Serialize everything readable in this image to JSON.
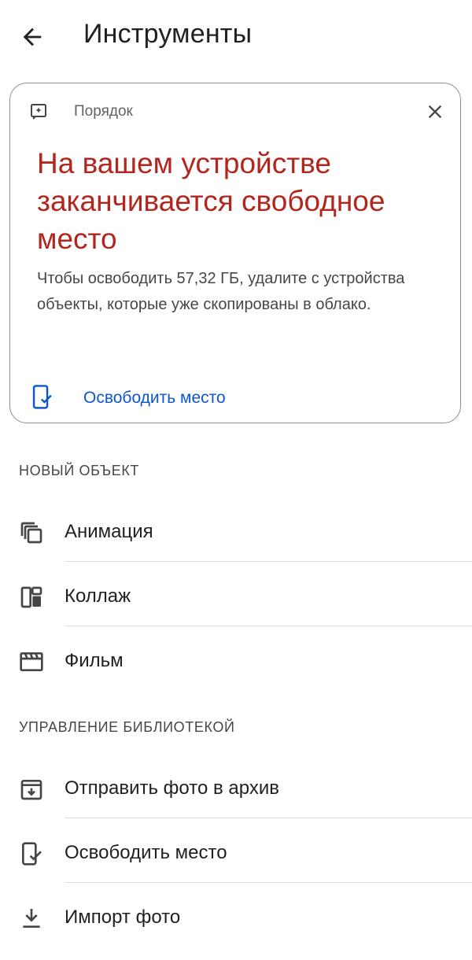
{
  "header": {
    "title": "Инструменты",
    "back_icon": "arrow-back-icon"
  },
  "card": {
    "label": "Порядок",
    "heading": "На вашем устройстве заканчивается свободное место",
    "body": "Чтобы освободить 57,32 ГБ, удалите с устройства объекты, которые уже скопированы в облако.",
    "action_label": "Освободить место",
    "accent_color": "#b3261e",
    "link_color": "#0b57d0"
  },
  "sections": {
    "new_object": "НОВЫЙ ОБЪЕКТ",
    "library": "УПРАВЛЕНИЕ БИБЛИОТЕКОЙ"
  },
  "items": [
    {
      "label": "Анимация",
      "icon": "animation-icon"
    },
    {
      "label": "Коллаж",
      "icon": "collage-icon"
    },
    {
      "label": "Фильм",
      "icon": "movie-icon"
    },
    {
      "label": "Отправить фото в архив",
      "icon": "archive-icon"
    },
    {
      "label": "Освободить место",
      "icon": "free-up-space-icon"
    },
    {
      "label": "Импорт фото",
      "icon": "import-icon"
    }
  ]
}
